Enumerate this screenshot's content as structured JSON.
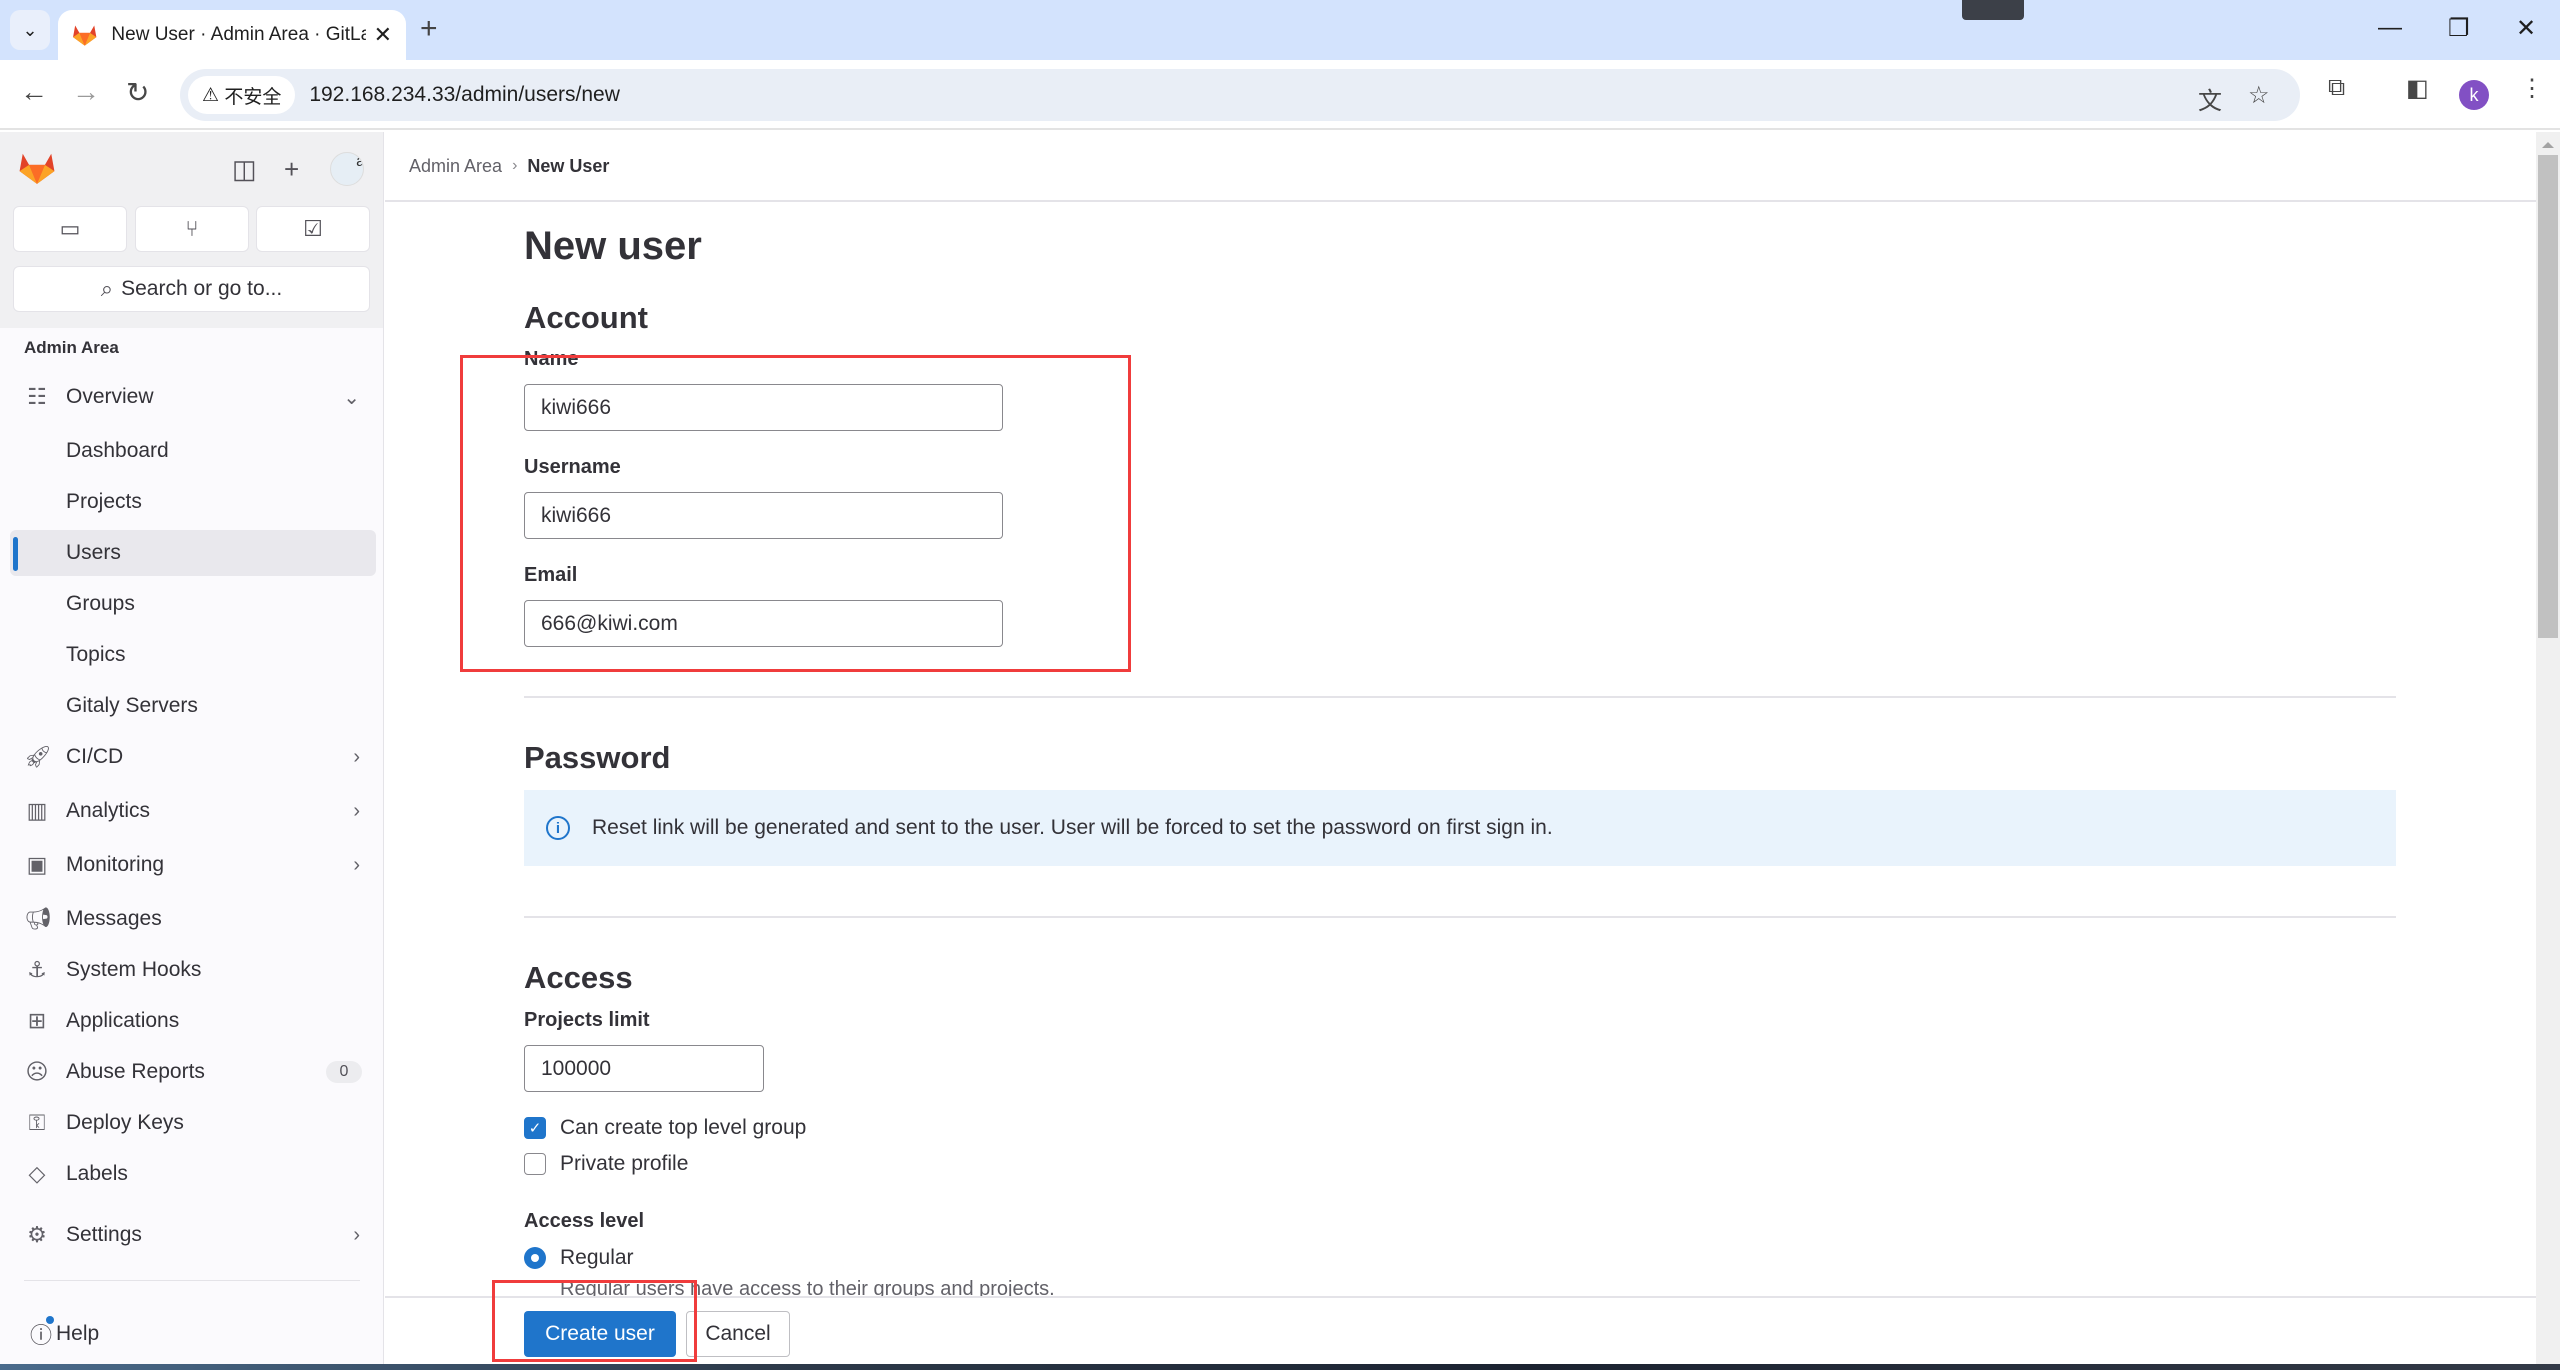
{
  "browser": {
    "tab_title": "New User · Admin Area · GitLab",
    "url": "192.168.234.33/admin/users/new",
    "security_label": "不安全",
    "profile_initial": "k"
  },
  "sidebar": {
    "search_label": "Search or go to...",
    "section_title": "Admin Area",
    "items": [
      {
        "label": "Overview",
        "icon": "overview-icon",
        "expanded": true
      },
      {
        "label": "Dashboard"
      },
      {
        "label": "Projects"
      },
      {
        "label": "Users",
        "active": true
      },
      {
        "label": "Groups"
      },
      {
        "label": "Topics"
      },
      {
        "label": "Gitaly Servers"
      },
      {
        "label": "CI/CD",
        "icon": "rocket-icon"
      },
      {
        "label": "Analytics",
        "icon": "chart-icon"
      },
      {
        "label": "Monitoring",
        "icon": "monitor-icon"
      },
      {
        "label": "Messages",
        "icon": "megaphone-icon"
      },
      {
        "label": "System Hooks",
        "icon": "anchor-icon"
      },
      {
        "label": "Applications",
        "icon": "apps-icon"
      },
      {
        "label": "Abuse Reports",
        "icon": "sad-face-icon",
        "badge": "0"
      },
      {
        "label": "Deploy Keys",
        "icon": "key-icon"
      },
      {
        "label": "Labels",
        "icon": "label-icon"
      },
      {
        "label": "Settings",
        "icon": "gear-icon"
      }
    ],
    "help_label": "Help"
  },
  "breadcrumb": {
    "parent": "Admin Area",
    "current": "New User"
  },
  "page": {
    "title": "New user",
    "account": {
      "heading": "Account",
      "name_label": "Name",
      "name_value": "kiwi666",
      "username_label": "Username",
      "username_value": "kiwi666",
      "email_label": "Email",
      "email_value": "666@kiwi.com"
    },
    "password": {
      "heading": "Password",
      "info": "Reset link will be generated and sent to the user. User will be forced to set the password on first sign in."
    },
    "access": {
      "heading": "Access",
      "projects_limit_label": "Projects limit",
      "projects_limit_value": "100000",
      "can_create_group_label": "Can create top level group",
      "can_create_group_checked": true,
      "private_profile_label": "Private profile",
      "private_profile_checked": false,
      "access_level_label": "Access level",
      "regular_label": "Regular",
      "regular_help": "Regular users have access to their groups and projects."
    },
    "actions": {
      "create_label": "Create user",
      "cancel_label": "Cancel"
    }
  },
  "colors": {
    "accent": "#1f75cb",
    "annotation": "#f03c3c",
    "info_bg": "#e9f3fc"
  }
}
